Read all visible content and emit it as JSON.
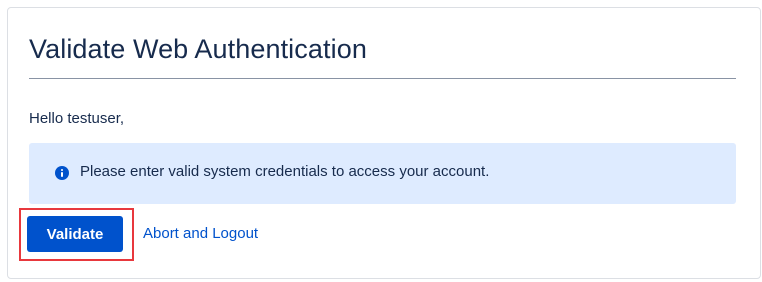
{
  "card": {
    "title": "Validate Web Authentication",
    "greeting": "Hello testuser,",
    "info_message": "Please enter valid system credentials to access your account.",
    "info_icon": "info-circle-icon"
  },
  "actions": {
    "validate_label": "Validate",
    "abort_label": "Abort and Logout"
  },
  "colors": {
    "primary": "#0052cc",
    "info_background": "#deebff",
    "text": "#172b4d",
    "highlight_border": "#e8383d"
  }
}
